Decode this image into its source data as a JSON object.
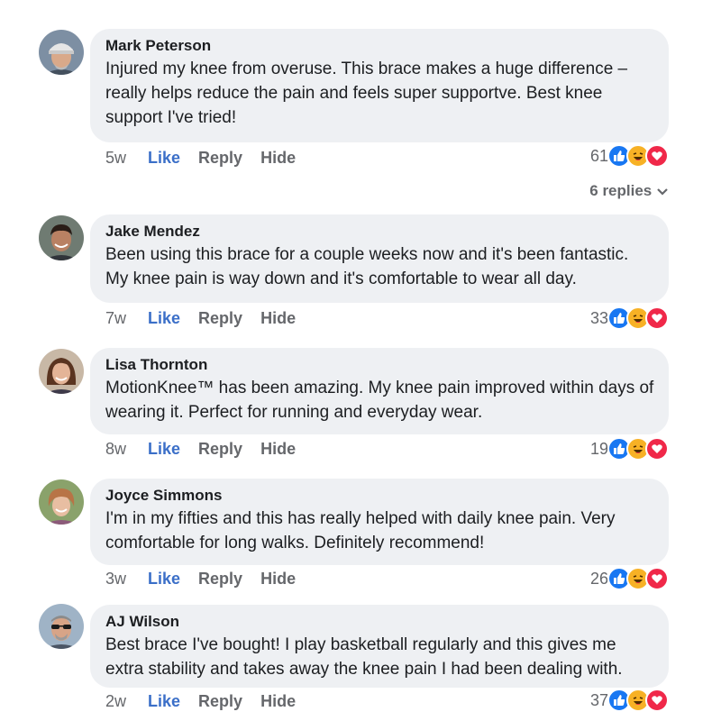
{
  "comments": [
    {
      "name": "Mark Peterson",
      "text": "Injured my knee from overuse. This brace makes a huge difference – really helps reduce the pain and feels super supportve. Best knee support I've tried!",
      "time": "5w",
      "like": "Like",
      "reply": "Reply",
      "hide": "Hide",
      "count": "61"
    },
    {
      "name": "Jake Mendez",
      "text": "Been using this brace for a couple weeks now and it's been fantastic. My knee pain is way down and it's comfortable to wear all day.",
      "time": "7w",
      "like": "Like",
      "reply": "Reply",
      "hide": "Hide",
      "count": "33"
    },
    {
      "name": "Lisa Thornton",
      "text": "MotionKnee™ has been amazing. My knee pain improved within days of wearing it. Perfect for running and everyday wear.",
      "time": "8w",
      "like": "Like",
      "reply": "Reply",
      "hide": "Hide",
      "count": "19"
    },
    {
      "name": "Joyce Simmons",
      "text": "I'm in my fifties and this has really helped with daily knee pain. Very comfortable for long walks. Definitely recommend!",
      "time": "3w",
      "like": "Like",
      "reply": "Reply",
      "hide": "Hide",
      "count": "26"
    },
    {
      "name": "AJ Wilson",
      "text": "Best brace I've bought! I play basketball regularly and this gives me extra stability and takes away the knee pain I had been dealing with.",
      "time": "2w",
      "like": "Like",
      "reply": "Reply",
      "hide": "Hide",
      "count": "37"
    }
  ],
  "replies_link": "6 replies",
  "colors": {
    "like_blue": "#3b6fc8",
    "bubble_bg": "#eef0f3",
    "meta_gray": "#65676b",
    "love_red": "#f02849",
    "haha_yellow": "#f7b125"
  },
  "icons": {
    "reactions": [
      "like-reaction-icon",
      "haha-reaction-icon",
      "love-reaction-icon"
    ],
    "replies": "chevron-down-icon"
  }
}
